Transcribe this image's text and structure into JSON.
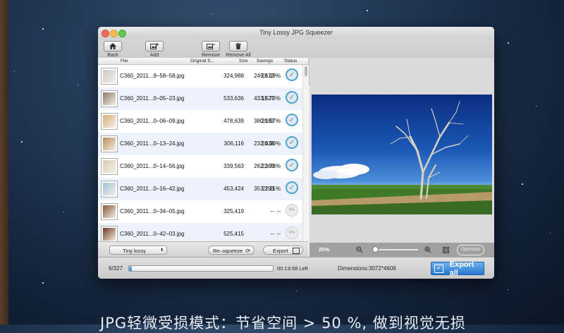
{
  "window": {
    "title": "Tiny Lossy JPG Squeezer"
  },
  "toolbar": {
    "back_label": "Back",
    "add_label": "Add",
    "remove_label": "Remove",
    "remove_all_label": "Remove All"
  },
  "columns": {
    "file": "File",
    "original_size": "Original S...",
    "size": "Size",
    "savings": "Savings",
    "status": "Status"
  },
  "files": [
    {
      "name": "C360_2011...9–58–58.jpg",
      "original": "324,988",
      "size": "249,612",
      "savings": "23.19%",
      "status": "done",
      "thumb_color": "#c9c9c9"
    },
    {
      "name": "C360_2011...0–05–23.jpg",
      "original": "533,636",
      "size": "433,527",
      "savings": "18.76%",
      "status": "done",
      "thumb_color": "#8b7a70"
    },
    {
      "name": "C360_2011...0–06–09.jpg",
      "original": "478,639",
      "size": "380,192",
      "savings": "20.57%",
      "status": "done",
      "thumb_color": "#d8b07a"
    },
    {
      "name": "C360_2011...0–13–24.jpg",
      "original": "306,116",
      "size": "232,038",
      "savings": "24.20%",
      "status": "done",
      "thumb_color": "#b98b5a"
    },
    {
      "name": "C360_2011...0–14–56.jpg",
      "original": "339,563",
      "size": "262,368",
      "savings": "22.73%",
      "status": "done",
      "thumb_color": "#d9cbb3"
    },
    {
      "name": "C360_2011...0–16–42.jpg",
      "original": "453,424",
      "size": "353,193",
      "savings": "22.11%",
      "status": "done",
      "thumb_color": "#9fc1d8"
    },
    {
      "name": "C360_2011...0–34–05.jpg",
      "original": "325,419",
      "size": "--",
      "savings": "--",
      "status": "0%",
      "thumb_color": "#8a5a3a"
    },
    {
      "name": "C360_2011...0–42–03.jpg",
      "original": "525,415",
      "size": "--",
      "savings": "--",
      "status": "0%",
      "thumb_color": "#6b3a1e"
    }
  ],
  "bottom": {
    "mode_select": "Tiny lossy",
    "resqueeze_label": "Re–squeeze",
    "export_label": "Export"
  },
  "preview": {
    "zoom": "25%",
    "zoom_fraction": 0.05,
    "badge": "Optimized"
  },
  "status": {
    "progress_text": "6/327",
    "progress_fraction": 0.02,
    "time_left": "00:13:58 Left",
    "dimensions": "Dimensions:3072*4608",
    "export_all_label": "Export all"
  },
  "caption": "JPG轻微受损模式：节省空间 > 50 %, 做到视觉无损",
  "colors": {
    "check_ring": "#4fa3d1",
    "export_all": "#2478d0",
    "desktop": "#1b2f4b"
  }
}
